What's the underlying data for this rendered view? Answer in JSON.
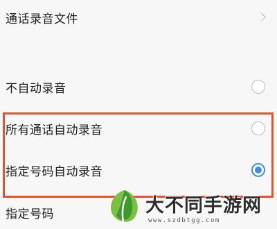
{
  "settings": {
    "recording_files_label": "通话录音文件",
    "options": [
      {
        "label": "不自动录音",
        "selected": false
      },
      {
        "label": "所有通话自动录音",
        "selected": false
      },
      {
        "label": "指定号码自动录音",
        "selected": true
      }
    ],
    "specified_numbers_label": "指定号码"
  },
  "colors": {
    "accent": "#3d8ee8",
    "highlight": "#e6542c"
  },
  "watermark": {
    "brand": "大不同手游网",
    "url": "www.szdbtgg.com"
  }
}
